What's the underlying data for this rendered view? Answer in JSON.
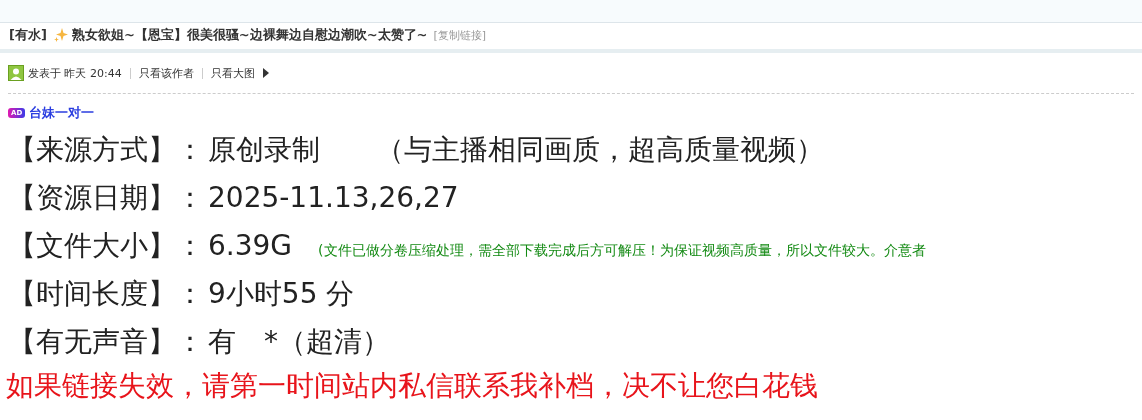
{
  "thread": {
    "category": "[有水]",
    "title": "熟女欲姐~【恩宝】很美很骚~边裸舞边自慰边潮吹~太赞了~",
    "copy_link": "[复制链接]"
  },
  "post_meta": {
    "posted": "发表于 昨天 20:44",
    "links": [
      "只看该作者",
      "只看大图"
    ]
  },
  "ad": {
    "badge": "AD",
    "text": "台妹一对一"
  },
  "details": [
    {
      "label": "【来源方式】：",
      "value": "原创录制",
      "note": {
        "kind": "large",
        "text": "（与主播相同画质，超高质量视频）"
      }
    },
    {
      "label": "【资源日期】：",
      "value": "2025-11.13,26,27"
    },
    {
      "label": "【文件大小】：",
      "value": "6.39G",
      "note": {
        "kind": "small",
        "text": "(文件已做分卷压缩处理，需全部下载完成后方可解压！为保证视频高质量，所以文件较大。介意者"
      }
    },
    {
      "label": "【时间长度】：",
      "value": "9小时55 分"
    },
    {
      "label": "【有无声音】：",
      "value": "有　*（超清）"
    }
  ],
  "notice": "如果链接失效，请第一时间站内私信联系我补档，决不让您白花钱"
}
